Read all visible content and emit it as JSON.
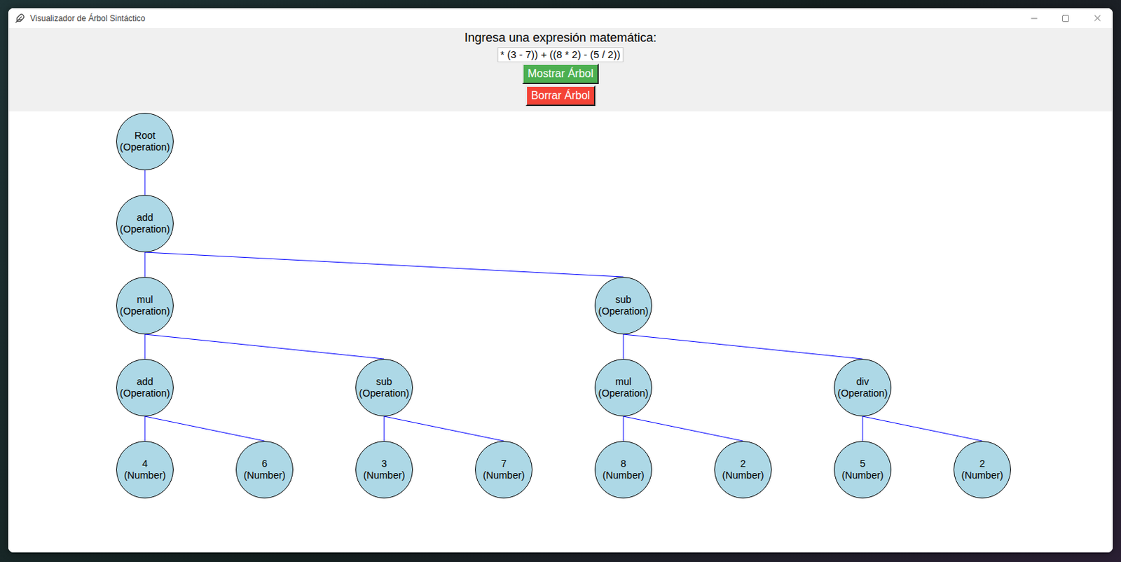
{
  "window": {
    "title": "Visualizador de Árbol Sintáctico"
  },
  "form": {
    "label": "Ingresa una expresión matemática:",
    "value": "* (3 - 7)) + ((8 * 2) - (5 / 2))"
  },
  "buttons": [
    {
      "label": "Mostrar Árbol",
      "color": "#4caf50"
    },
    {
      "label": "Borrar Árbol",
      "color": "#f44336"
    }
  ],
  "tree": {
    "name": "Root",
    "type": "(Operation)",
    "children": [
      {
        "name": "add",
        "type": "(Operation)",
        "children": [
          {
            "name": "mul",
            "type": "(Operation)",
            "children": [
              {
                "name": "add",
                "type": "(Operation)",
                "children": [
                  {
                    "name": "4",
                    "type": "(Number)",
                    "children": []
                  },
                  {
                    "name": "6",
                    "type": "(Number)",
                    "children": []
                  }
                ]
              },
              {
                "name": "sub",
                "type": "(Operation)",
                "children": [
                  {
                    "name": "3",
                    "type": "(Number)",
                    "children": []
                  },
                  {
                    "name": "7",
                    "type": "(Number)",
                    "children": []
                  }
                ]
              }
            ]
          },
          {
            "name": "sub",
            "type": "(Operation)",
            "children": [
              {
                "name": "mul",
                "type": "(Operation)",
                "children": [
                  {
                    "name": "8",
                    "type": "(Number)",
                    "children": []
                  },
                  {
                    "name": "2",
                    "type": "(Number)",
                    "children": []
                  }
                ]
              },
              {
                "name": "div",
                "type": "(Operation)",
                "children": [
                  {
                    "name": "5",
                    "type": "(Number)",
                    "children": []
                  },
                  {
                    "name": "2",
                    "type": "(Number)",
                    "children": []
                  }
                ]
              }
            ]
          }
        ]
      }
    ]
  }
}
